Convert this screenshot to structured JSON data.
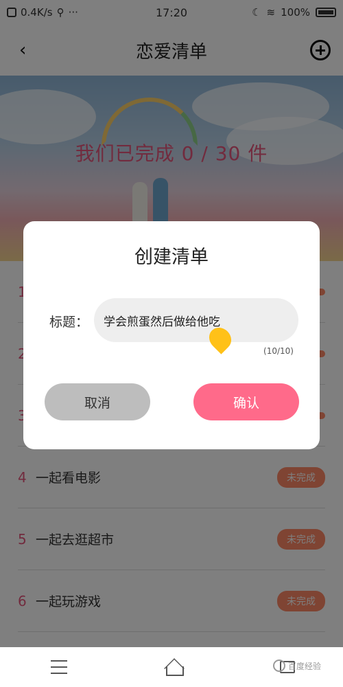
{
  "status_bar": {
    "network_speed": "0.4K/s",
    "time": "17:20",
    "battery": "100%"
  },
  "header": {
    "back_icon_name": "back-arrow-icon",
    "title": "恋爱清单",
    "add_icon_name": "plus-circle-icon"
  },
  "banner": {
    "progress_text": "我们已完成 0 / 30 件",
    "completed": 0,
    "total": 30
  },
  "list": {
    "items": [
      {
        "num": "1",
        "title": "",
        "status": ""
      },
      {
        "num": "2",
        "title": "",
        "status": ""
      },
      {
        "num": "3",
        "title": "",
        "status": ""
      },
      {
        "num": "4",
        "title": "一起看电影",
        "status": "未完成"
      },
      {
        "num": "5",
        "title": "一起去逛超市",
        "status": "未完成"
      },
      {
        "num": "6",
        "title": "一起玩游戏",
        "status": "未完成"
      }
    ]
  },
  "dialog": {
    "title": "创建清单",
    "field_label": "标题：",
    "field_value": "学会煎蛋然后做给他吃",
    "char_counter": "(10/10)",
    "cancel_label": "取消",
    "confirm_label": "确认"
  },
  "watermark": {
    "text": "百度经验"
  },
  "colors": {
    "accent_pink": "#ff6a8a",
    "badge_orange": "#ff8866",
    "cancel_gray": "#bdbdbd",
    "cursor_yellow": "#ffc118"
  }
}
